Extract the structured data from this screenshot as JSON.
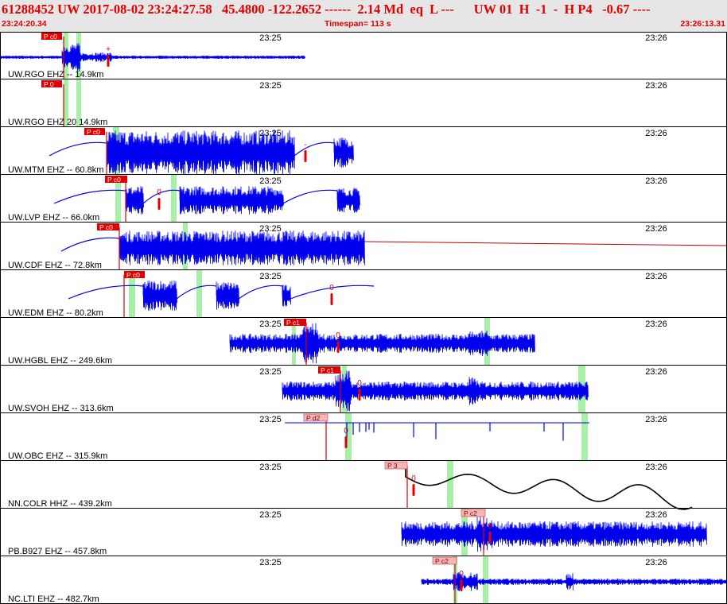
{
  "header": {
    "title": "61288452 UW 2017-08-02 23:24:27.58   45.4800 -122.2652 ------  2.14 Md  eq  L ---      UW 01  H  -1  -  H P4   -0.67 ----",
    "start_time": "23:24:20.34",
    "timespan": "Timespan= 113 s",
    "end_time": "23:26:13.31"
  },
  "time_ticks": [
    "23:25",
    "23:26"
  ],
  "colors": {
    "trace": "#0000ee",
    "trace_alt": "#000000",
    "pick_marker": "#e00000",
    "highlight": "#a8f0a8",
    "pick_label_bg": "#e00000",
    "pick_label_bg_light": "#f5b5b5",
    "panel_border": "#000000",
    "header_bg": "#e6e6e6",
    "header_text": "#e00000"
  },
  "panels": [
    {
      "label": "UW.RGO EHZ -- 14.9km",
      "pick": "P c0",
      "pick_style": "solid",
      "amp_mark": "+"
    },
    {
      "label": "UW.RGO EHZ 20 14.9km",
      "pick": "P 0",
      "pick_style": "solid",
      "amp_mark": ""
    },
    {
      "label": "UW.MTM EHZ -- 60.8km",
      "pick": "P c0",
      "pick_style": "solid",
      "amp_mark": "-"
    },
    {
      "label": "UW.LVP EHZ -- 66.0km",
      "pick": "P c0",
      "pick_style": "solid",
      "amp_mark": "0"
    },
    {
      "label": "UW.CDF EHZ -- 72.8km",
      "pick": "P c0",
      "pick_style": "solid",
      "amp_mark": ""
    },
    {
      "label": "UW.EDM EHZ -- 80.2km",
      "pick": "P c0",
      "pick_style": "solid",
      "amp_mark": "0"
    },
    {
      "label": "UW.HGBL EHZ -- 249.6km",
      "pick": "P c1",
      "pick_style": "solid",
      "amp_mark": "0"
    },
    {
      "label": "UW.SVOH EHZ -- 313.6km",
      "pick": "P c1",
      "pick_style": "solid",
      "amp_mark": "0"
    },
    {
      "label": "UW.OBC EHZ -- 315.9km",
      "pick": "P d2",
      "pick_style": "light",
      "amp_mark": "0"
    },
    {
      "label": "NN.COLR HHZ -- 439.2km",
      "pick": "P 3",
      "pick_style": "light",
      "amp_mark": "0"
    },
    {
      "label": "PB.B927 EHZ -- 457.8km",
      "pick": "P c2",
      "pick_style": "light",
      "amp_mark": "0"
    },
    {
      "label": "NC.LTI EHZ -- 482.7km",
      "pick": "P c2",
      "pick_style": "light",
      "amp_mark": "0"
    }
  ]
}
